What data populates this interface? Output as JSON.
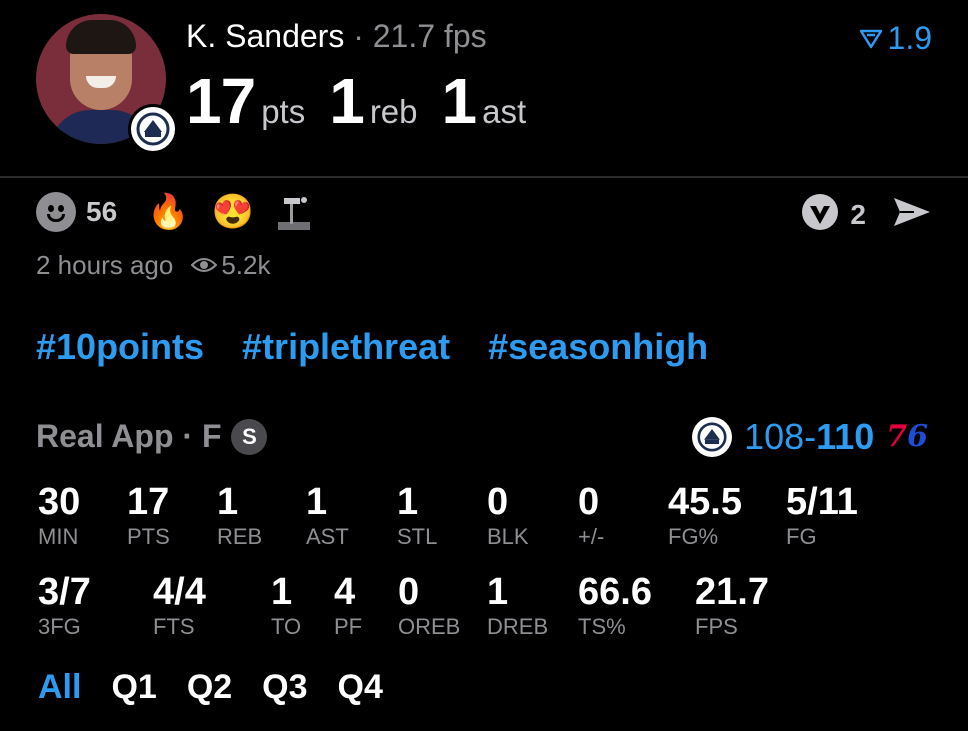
{
  "player": {
    "name": "K. Sanders",
    "separator": "·",
    "fps": "21.7 fps",
    "pts_value": "17",
    "pts_label": "pts",
    "reb_value": "1",
    "reb_label": "reb",
    "ast_value": "1",
    "ast_label": "ast",
    "rating": "1.9"
  },
  "reactions": {
    "count": "56",
    "emoji_fire": "🔥",
    "emoji_hearteyes": "😍",
    "share_count": "2",
    "time_ago": "2 hours ago",
    "views": "5.2k"
  },
  "tags": [
    "#10points",
    "#triplethreat",
    "#seasonhigh"
  ],
  "game": {
    "source": "Real App · F",
    "s_badge": "S",
    "score_left": "108",
    "score_dash": "-",
    "score_right": "110",
    "opp_7": "7",
    "opp_6": "6"
  },
  "stats_row1": [
    {
      "value": "30",
      "label": "MIN"
    },
    {
      "value": "17",
      "label": "PTS"
    },
    {
      "value": "1",
      "label": "REB"
    },
    {
      "value": "1",
      "label": "AST"
    },
    {
      "value": "1",
      "label": "STL"
    },
    {
      "value": "0",
      "label": "BLK"
    },
    {
      "value": "0",
      "label": "+/-"
    },
    {
      "value": "45.5",
      "label": "FG%"
    },
    {
      "value": "5/11",
      "label": "FG"
    }
  ],
  "stats_row2": [
    {
      "value": "3/7",
      "label": "3FG"
    },
    {
      "value": "4/4",
      "label": "FTS"
    },
    {
      "value": "1",
      "label": "TO"
    },
    {
      "value": "4",
      "label": "PF"
    },
    {
      "value": "0",
      "label": "OREB"
    },
    {
      "value": "1",
      "label": "DREB"
    },
    {
      "value": "66.6",
      "label": "TS%"
    },
    {
      "value": "21.7",
      "label": "FPS"
    }
  ],
  "quarters": [
    "All",
    "Q1",
    "Q2",
    "Q3",
    "Q4"
  ],
  "colors": {
    "accent": "#2d9bf0",
    "muted": "#8e8e93",
    "background": "#000000"
  }
}
